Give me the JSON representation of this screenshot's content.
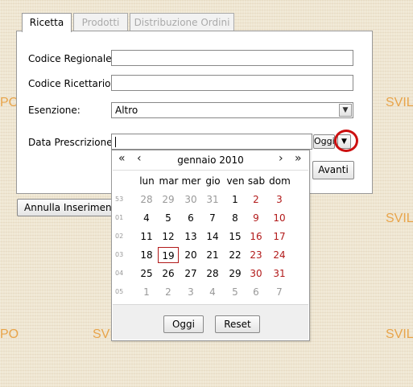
{
  "watermark": {
    "left": "PO",
    "right": "SVIL"
  },
  "tabs": [
    {
      "label": "Ricetta",
      "active": true
    },
    {
      "label": "Prodotti",
      "active": false
    },
    {
      "label": "Distribuzione Ordini",
      "active": false
    }
  ],
  "form": {
    "codice_regionale_label": "Codice Regionale:",
    "codice_regionale_value": "",
    "codice_ricettario_label": "Codice Ricettario:",
    "codice_ricettario_value": "",
    "esenzione_label": "Esenzione:",
    "esenzione_value": "Altro",
    "data_label": "Data Prescrizione:",
    "data_value": "",
    "oggi_button": "Oggi",
    "avanti_button": "Avanti"
  },
  "annulla_button": "Annulla Inserimento",
  "calendar": {
    "prev_year": "«",
    "prev_month": "‹",
    "next_month": "›",
    "next_year": "»",
    "month_label": "gennaio 2010",
    "weekdays": [
      "lun",
      "mar",
      "mer",
      "gio",
      "ven",
      "sab",
      "dom"
    ],
    "weeks": [
      {
        "num": "53",
        "days": [
          "28",
          "29",
          "30",
          "31",
          "1",
          "2",
          "3"
        ]
      },
      {
        "num": "01",
        "days": [
          "4",
          "5",
          "6",
          "7",
          "8",
          "9",
          "10"
        ]
      },
      {
        "num": "02",
        "days": [
          "11",
          "12",
          "13",
          "14",
          "15",
          "16",
          "17"
        ]
      },
      {
        "num": "03",
        "days": [
          "18",
          "19",
          "20",
          "21",
          "22",
          "23",
          "24"
        ]
      },
      {
        "num": "04",
        "days": [
          "25",
          "26",
          "27",
          "28",
          "29",
          "30",
          "31"
        ]
      },
      {
        "num": "05",
        "days": [
          "1",
          "2",
          "3",
          "4",
          "5",
          "6",
          "7"
        ]
      }
    ],
    "today_button": "Oggi",
    "reset_button": "Reset"
  },
  "colors": {
    "weekend": "#b21a1a",
    "highlight_ring": "#cc1010",
    "watermark": "#e8a44a"
  }
}
